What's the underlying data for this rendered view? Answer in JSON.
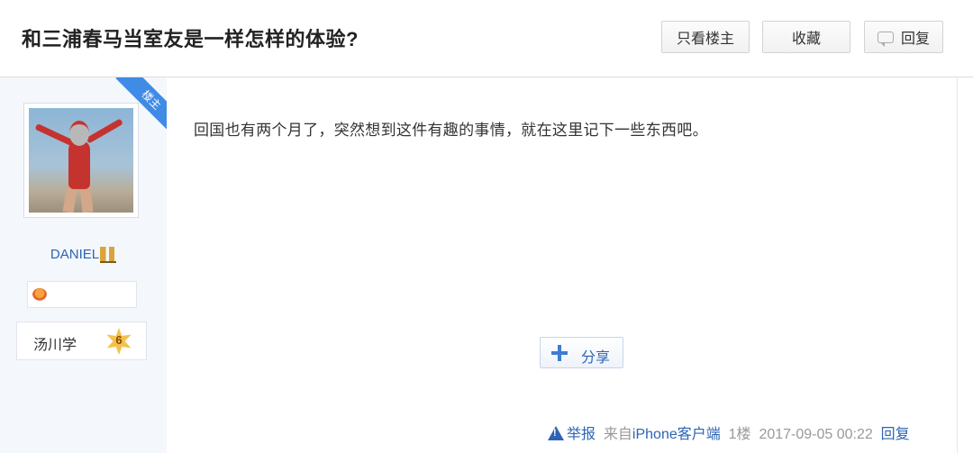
{
  "header": {
    "title": "和三浦春马当室友是一样怎样的体验?",
    "buttons": {
      "only_op": "只看楼主",
      "favorite": "收藏",
      "reply": "回复"
    }
  },
  "author": {
    "ribbon": "楼主",
    "name": "DANIEL",
    "forum_badge": "汤川学",
    "level": "6"
  },
  "post": {
    "text": "回国也有两个月了，突然想到这件有趣的事情，就在这里记下一些东西吧。",
    "share_label": "分享"
  },
  "footer": {
    "report": "举报",
    "source_prefix": "来自",
    "source_client": "iPhone客户端",
    "floor": "1楼",
    "datetime": "2017-09-05 00:22",
    "reply": "回复"
  },
  "colors": {
    "link_blue": "#2d64b3",
    "ribbon_blue": "#3f8be6",
    "sidebar_bg": "#f4f7fc"
  }
}
